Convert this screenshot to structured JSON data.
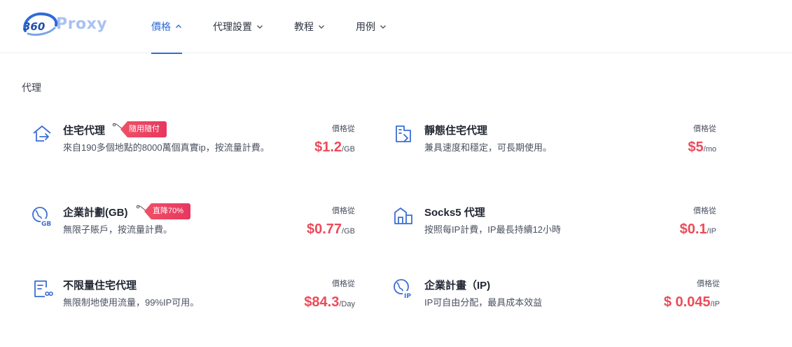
{
  "brand": {
    "logo_number": "360",
    "logo_text": "Proxy"
  },
  "nav": {
    "items": [
      {
        "label": "價格",
        "expanded": true
      },
      {
        "label": "代理設置",
        "expanded": false
      },
      {
        "label": "教程",
        "expanded": false
      },
      {
        "label": "用例",
        "expanded": false
      }
    ]
  },
  "section": {
    "title": "代理"
  },
  "products": [
    {
      "name": "住宅代理",
      "tag": "隨用隨付",
      "icon": "residential-proxy-icon",
      "desc": "來自190多個地點的8000萬個真實ip，按流量計費。",
      "from_label": "價格從",
      "price": "$1.2",
      "unit": "/GB"
    },
    {
      "name": "靜態住宅代理",
      "tag": "",
      "icon": "static-residential-icon",
      "desc": "兼具速度和穩定，可長期使用。",
      "from_label": "價格從",
      "price": "$5",
      "unit": "/mo"
    },
    {
      "name": "企業計劃(GB)",
      "tag": "直降70%",
      "icon": "enterprise-gb-icon",
      "desc": "無限子賬戶，按流量計費。",
      "from_label": "價格從",
      "price": "$0.77",
      "unit": "/GB"
    },
    {
      "name": "Socks5 代理",
      "tag": "",
      "icon": "socks5-icon",
      "desc": "按照每IP計費，IP最長持續12小時",
      "from_label": "價格從",
      "price": "$0.1",
      "unit": "/IP"
    },
    {
      "name": "不限量住宅代理",
      "tag": "",
      "icon": "unlimited-residential-icon",
      "desc": "無限制地使用流量，99%IP可用。",
      "from_label": "價格從",
      "price": "$84.3",
      "unit": "/Day"
    },
    {
      "name": "企業計畫（IP)",
      "tag": "",
      "icon": "enterprise-ip-icon",
      "desc": "IP可自由分配，最具成本效益",
      "from_label": "價格從",
      "price": "$ 0.045",
      "unit": "/IP"
    }
  ],
  "colors": {
    "accent": "#2f6bd8",
    "price": "#ec4b5a",
    "tag": "#e8365f",
    "icon": "#3b6fd4"
  }
}
